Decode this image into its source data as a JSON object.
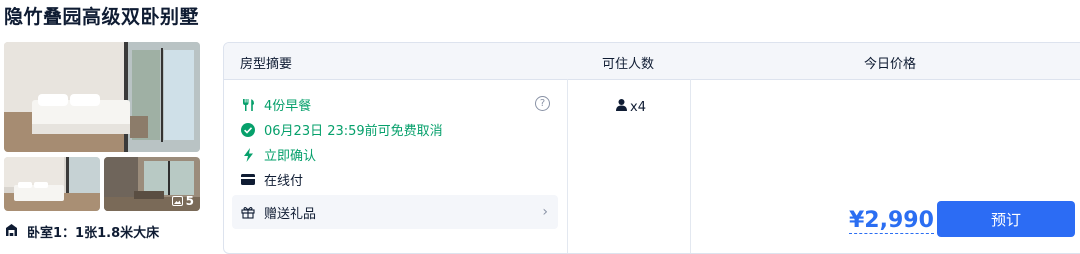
{
  "room": {
    "title": "隐竹叠园高级双卧别墅",
    "photo_count": "5",
    "bed_info": "卧室1：1张1.8米大床"
  },
  "table": {
    "headers": {
      "summary": "房型摘要",
      "occupancy": "可住人数",
      "price": "今日价格"
    },
    "features": {
      "breakfast": "4份早餐",
      "cancel": "06月23日 23:59前可免费取消",
      "confirm": "立即确认",
      "payment": "在线付",
      "gift": "赠送礼品"
    },
    "help_symbol": "?",
    "gift_chevron": "›",
    "occupancy": "x4",
    "price": "¥2,990",
    "book_label": "预订"
  },
  "colors": {
    "accent": "#2c6cf4",
    "price": "#2b6ef2",
    "green": "#06a06b",
    "text": "#0f1c33"
  },
  "icons": {
    "breakfast": "fork-knife-icon",
    "cancel": "check-circle-icon",
    "confirm": "lightning-icon",
    "payment": "card-icon",
    "gift": "gift-icon",
    "occupancy": "person-icon",
    "photos": "image-icon",
    "bed": "bed-icon"
  }
}
